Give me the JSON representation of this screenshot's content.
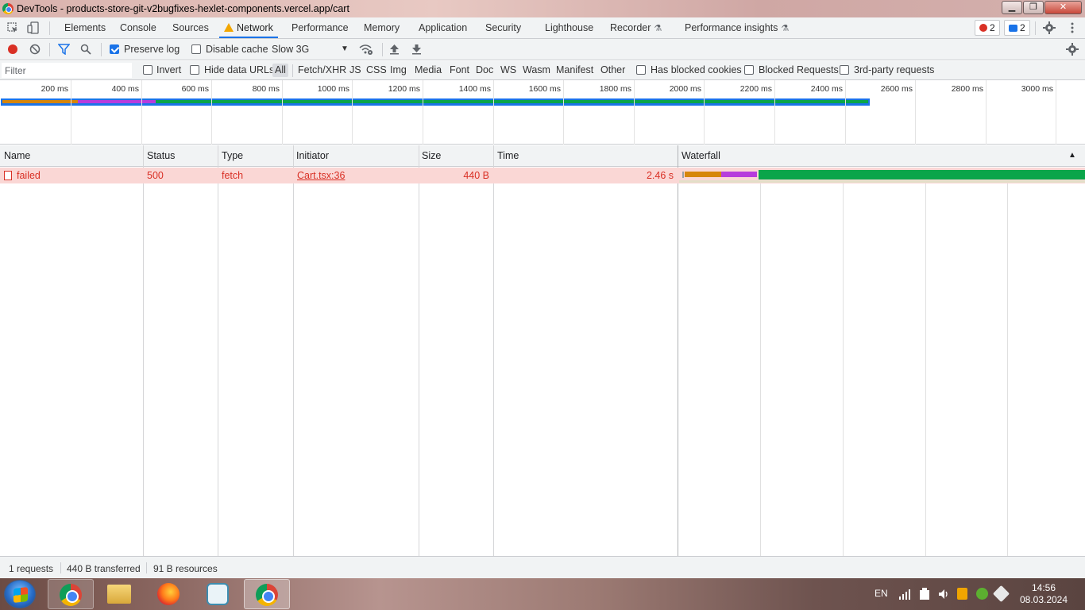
{
  "window": {
    "title": "DevTools - products-store-git-v2bugfixes-hexlet-components.vercel.app/cart"
  },
  "tabs": [
    {
      "label": "Elements"
    },
    {
      "label": "Console"
    },
    {
      "label": "Sources"
    },
    {
      "label": "Network"
    },
    {
      "label": "Performance"
    },
    {
      "label": "Memory"
    },
    {
      "label": "Application"
    },
    {
      "label": "Security"
    },
    {
      "label": "Lighthouse"
    },
    {
      "label": "Recorder"
    },
    {
      "label": "Performance insights"
    }
  ],
  "badges": {
    "errors": "2",
    "messages": "2"
  },
  "toolbar": {
    "preserve_log": "Preserve log",
    "preserve_log_checked": true,
    "disable_cache": "Disable cache",
    "throttling": "Slow 3G"
  },
  "filter": {
    "placeholder": "Filter",
    "invert": "Invert",
    "hide_data_urls": "Hide data URLs",
    "types": [
      "All",
      "Fetch/XHR",
      "JS",
      "CSS",
      "Img",
      "Media",
      "Font",
      "Doc",
      "WS",
      "Wasm",
      "Manifest",
      "Other"
    ],
    "has_blocked_cookies": "Has blocked cookies",
    "blocked_requests": "Blocked Requests",
    "third_party": "3rd-party requests"
  },
  "overview": {
    "ticks": [
      "200 ms",
      "400 ms",
      "600 ms",
      "800 ms",
      "1000 ms",
      "1200 ms",
      "1400 ms",
      "1600 ms",
      "1800 ms",
      "2000 ms",
      "2200 ms",
      "2400 ms",
      "2600 ms",
      "2800 ms",
      "3000 ms"
    ]
  },
  "table": {
    "columns": [
      "Name",
      "Status",
      "Type",
      "Initiator",
      "Size",
      "Time",
      "Waterfall"
    ],
    "sort_indicator": "▲",
    "rows": [
      {
        "name": "failed",
        "status": "500",
        "type": "fetch",
        "initiator": "Cart.tsx:36",
        "size": "440 B",
        "time": "2.46 s"
      }
    ]
  },
  "status": {
    "requests": "1 requests",
    "transferred": "440 B transferred",
    "resources": "91 B resources"
  },
  "taskbar": {
    "lang": "EN",
    "time": "14:56",
    "date": "08.03.2024"
  },
  "colors": {
    "accent": "#1a73e8",
    "error_row": "#fad7d5",
    "error_text": "#d93025",
    "waiting": "#d6860a",
    "ssl": "#b73cdc",
    "download": "#0aa54a"
  }
}
